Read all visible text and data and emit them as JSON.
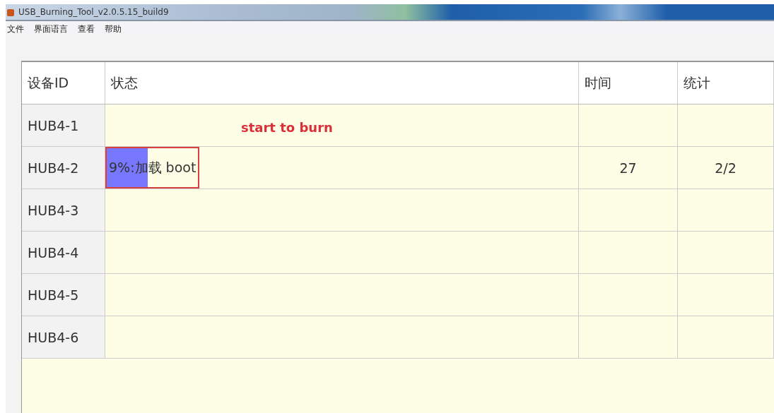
{
  "window": {
    "title": "USB_Burning_Tool_v2.0.5.15_build9"
  },
  "menu": [
    "文件",
    "界面语言",
    "查看",
    "帮助"
  ],
  "table": {
    "columns": [
      "设备ID",
      "状态",
      "时间",
      "统计"
    ],
    "rows": [
      {
        "device": "HUB4-1",
        "note": "start to burn"
      },
      {
        "device": "HUB4-2",
        "progress": {
          "level": 0.09,
          "text": "9%:加载 boot",
          "outlined": true
        },
        "time": "27",
        "count": "2/2"
      },
      {
        "device": "HUB4-3"
      },
      {
        "device": "HUB4-4"
      },
      {
        "device": "HUB4-5"
      },
      {
        "device": "HUB4-6"
      }
    ]
  }
}
